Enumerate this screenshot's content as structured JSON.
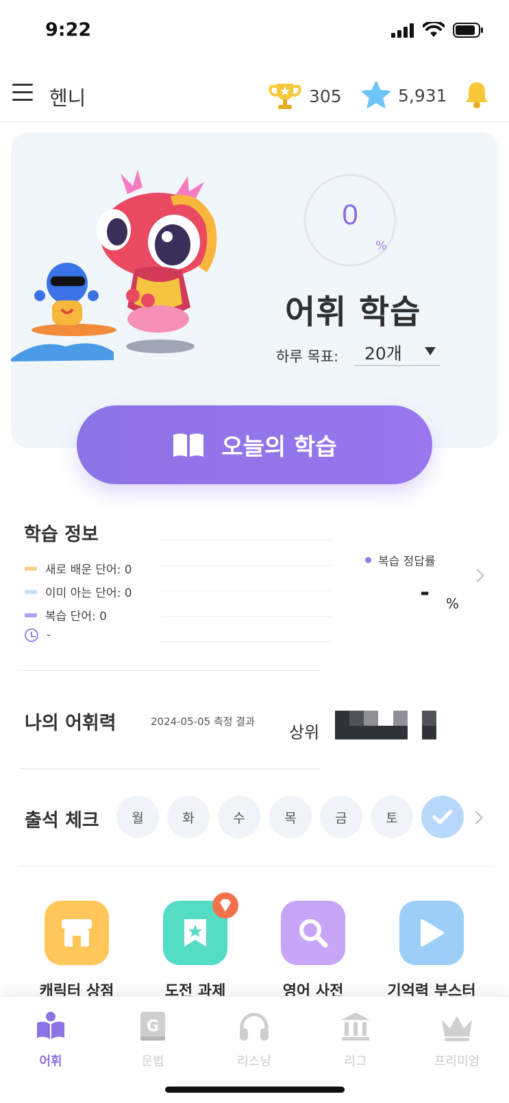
{
  "status_bar": {
    "time": "9:22"
  },
  "header": {
    "profile_name": "헨니",
    "trophy_count": "305",
    "star_count": "5,931"
  },
  "hero": {
    "progress_value": "0",
    "progress_unit": "%",
    "progress_fraction": 0,
    "title": "어휘 학습",
    "goal_label": "하루 목표:",
    "goal_value": "20개",
    "start_button": "오늘의 학습"
  },
  "learn_info": {
    "title": "학습 정보",
    "legend": [
      {
        "label": "새로 배운 단어: 0",
        "color": "#f7d487"
      },
      {
        "label": "이미 아는 단어: 0",
        "color": "#c9e2f8"
      },
      {
        "label": "복습 단어: 0",
        "color": "#b79df0"
      }
    ],
    "time_value": "-",
    "review_legend": "복습 정답률",
    "review_value": "-",
    "review_unit": "%"
  },
  "vocab_power": {
    "title": "나의 어휘력",
    "date": "2024-05-05 측정 결과",
    "rank_label": "상위"
  },
  "attendance": {
    "title": "출석 체크",
    "days": [
      "월",
      "화",
      "수",
      "목",
      "금",
      "토"
    ]
  },
  "quick_actions": [
    {
      "label": "캐릭터 상점",
      "color": "#ffc75a"
    },
    {
      "label": "도전 과제",
      "color": "#55dcc5"
    },
    {
      "label": "영어 사전",
      "color": "#c8a6f7"
    },
    {
      "label": "기억력 부스터",
      "color": "#9ccff8"
    }
  ],
  "bottom_nav": [
    {
      "label": "어휘"
    },
    {
      "label": "문법"
    },
    {
      "label": "리스닝"
    },
    {
      "label": "리그"
    },
    {
      "label": "프리미엄"
    }
  ],
  "colors": {
    "accent": "#8c73e6",
    "card_bg": "#f1f6fb"
  }
}
